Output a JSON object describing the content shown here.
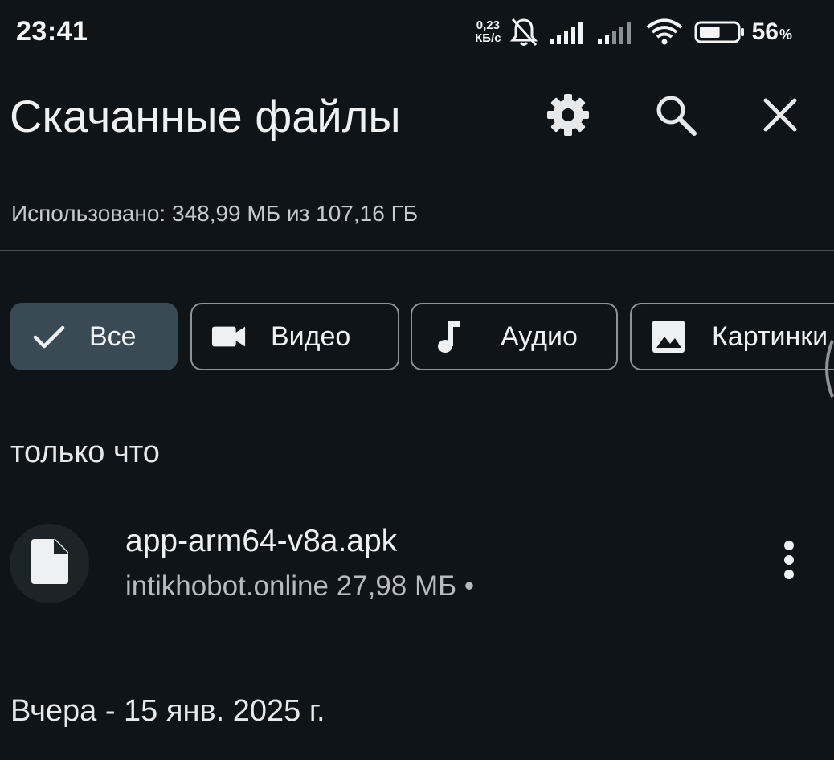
{
  "status_bar": {
    "time": "23:41",
    "net_speed_value": "0,23",
    "net_speed_unit": "КБ/с",
    "battery_percent": "56",
    "battery_symbol": "%",
    "battery_level": 0.56
  },
  "app_bar": {
    "title": "Скачанные файлы",
    "icons": [
      "gear-icon",
      "search-icon",
      "close-icon"
    ]
  },
  "storage": {
    "usage_text": "Использовано: 348,99 МБ из 107,16 ГБ"
  },
  "filters": [
    {
      "label": "Все",
      "icon": "check-icon",
      "selected": true
    },
    {
      "label": "Видео",
      "icon": "videocam-icon",
      "selected": false
    },
    {
      "label": "Аудио",
      "icon": "music-note-icon",
      "selected": false
    },
    {
      "label": "Картинки",
      "icon": "image-icon",
      "selected": false
    }
  ],
  "sections": [
    {
      "header": "только что",
      "items": [
        {
          "name": "app-arm64-v8a.apk",
          "meta": "intikhobot.online 27,98 МБ •",
          "icon": "file-icon"
        }
      ]
    },
    {
      "header": "Вчера - 15 янв. 2025 г.",
      "items": []
    }
  ],
  "colors": {
    "background": "#0e1418",
    "selected_chip": "#3a4a55",
    "chip_border": "#8d9497",
    "text_primary": "#eef0f1",
    "text_secondary": "#b6bbbe"
  }
}
